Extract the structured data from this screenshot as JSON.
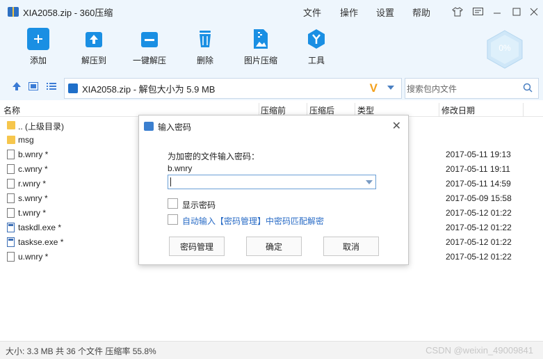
{
  "window": {
    "title": "XIA2058.zip - 360压缩"
  },
  "menu": {
    "items": [
      "文件",
      "操作",
      "设置",
      "帮助"
    ]
  },
  "toolbar": {
    "buttons": [
      "添加",
      "解压到",
      "一键解压",
      "删除",
      "图片压缩",
      "工具"
    ],
    "gauge_label": "0%"
  },
  "addressbar": {
    "path": "XIA2058.zip - 解包大小为 5.9 MB",
    "search_placeholder": "搜索包内文件"
  },
  "columns": [
    "名称",
    "压缩前",
    "压缩后",
    "类型",
    "修改日期"
  ],
  "files": [
    {
      "name": ".. (上级目录)",
      "type": "folder",
      "date": ""
    },
    {
      "name": "msg",
      "type": "folder",
      "date": ""
    },
    {
      "name": "b.wnry *",
      "type": "doc",
      "date": "2017-05-11 19:13"
    },
    {
      "name": "c.wnry *",
      "type": "doc",
      "date": "2017-05-11 19:11"
    },
    {
      "name": "r.wnry *",
      "type": "doc",
      "date": "2017-05-11 14:59"
    },
    {
      "name": "s.wnry *",
      "type": "doc",
      "date": "2017-05-09 15:58"
    },
    {
      "name": "t.wnry *",
      "type": "doc",
      "date": "2017-05-12 01:22"
    },
    {
      "name": "taskdl.exe *",
      "type": "exe",
      "date": "2017-05-12 01:22"
    },
    {
      "name": "taskse.exe *",
      "type": "exe",
      "date": "2017-05-12 01:22"
    },
    {
      "name": "u.wnry *",
      "type": "doc",
      "date": "2017-05-12 01:22"
    }
  ],
  "statusbar": {
    "text": "大小: 3.3 MB 共 36 个文件 压缩率 55.8%",
    "watermark": "CSDN @weixin_49009841"
  },
  "dialog": {
    "title": "输入密码",
    "prompt": "为加密的文件输入密码：",
    "filename": "b.wnry",
    "password_value": "",
    "show_password_label": "显示密码",
    "auto_match_label": "自动输入【密码管理】中密码匹配解密",
    "buttons": {
      "manage": "密码管理",
      "ok": "确定",
      "cancel": "取消"
    }
  },
  "colors": {
    "accent": "#1a8fe3",
    "link": "#2a6cc6",
    "warning": "#f3a11c"
  }
}
